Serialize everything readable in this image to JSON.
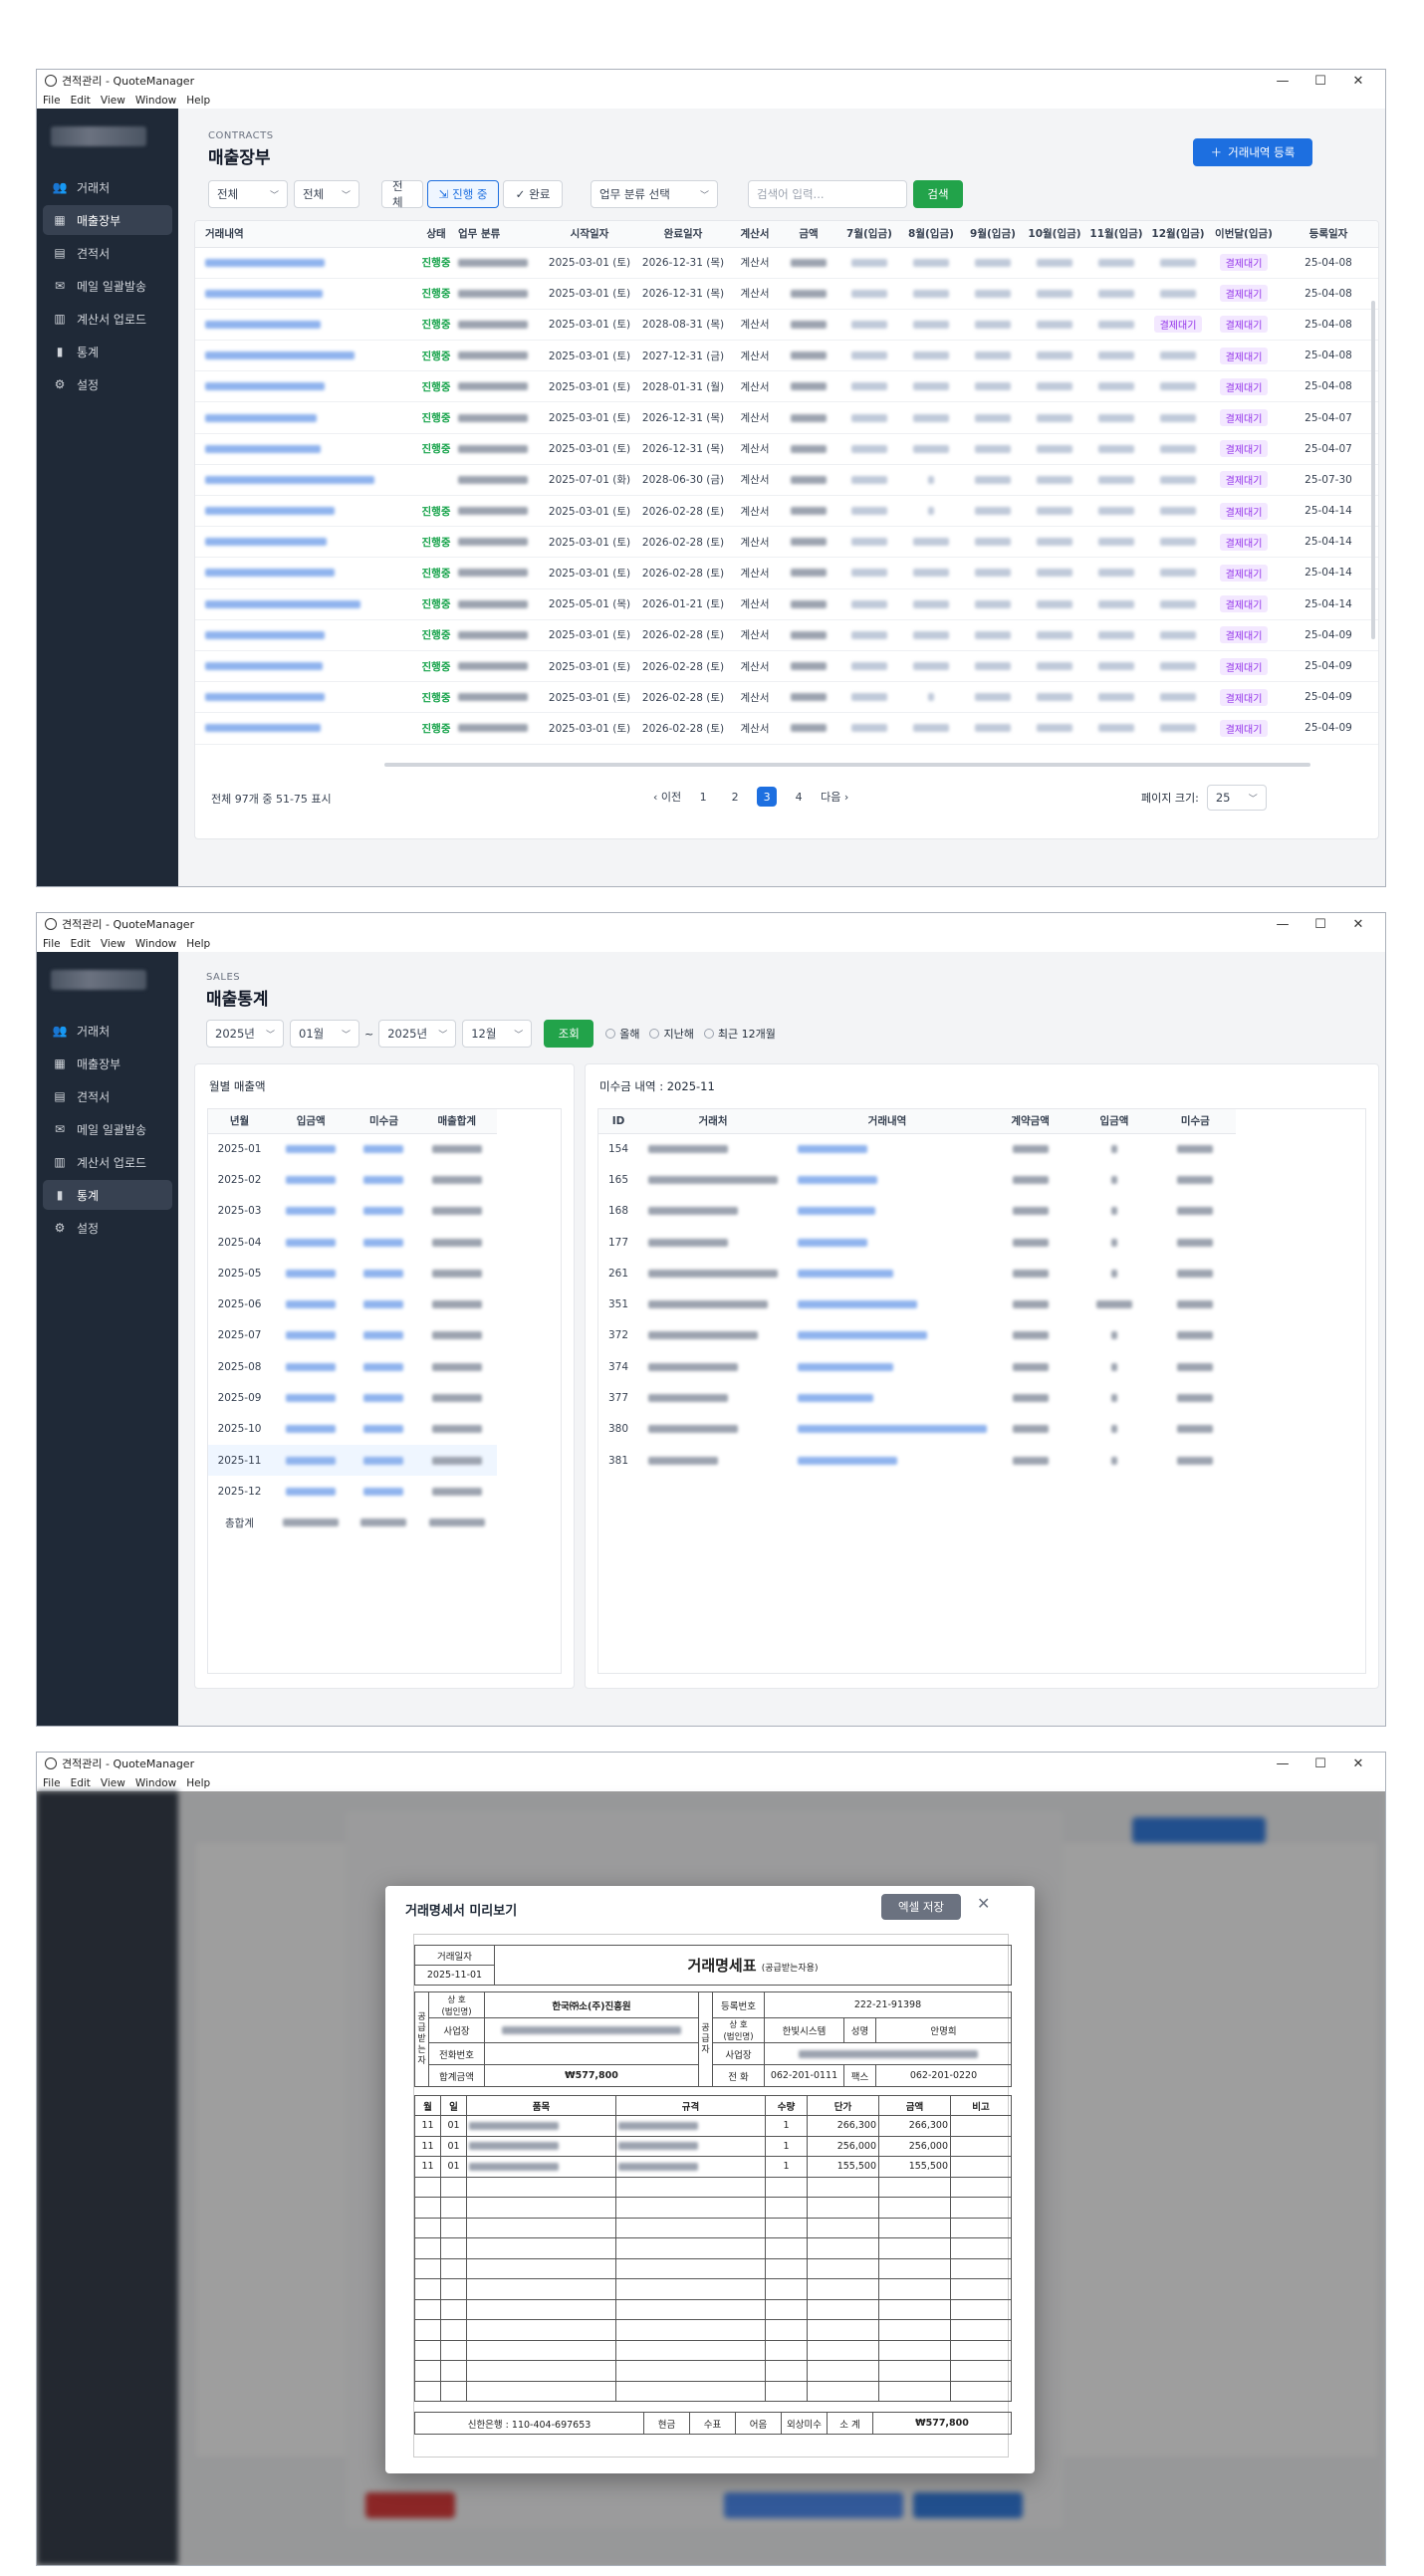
{
  "app": {
    "window_title": "견적관리 - QuoteManager",
    "menu": [
      "File",
      "Edit",
      "View",
      "Window",
      "Help"
    ]
  },
  "sidebar": {
    "items": [
      {
        "label": "거래처",
        "icon": "users-icon"
      },
      {
        "label": "매출장부",
        "icon": "grid-icon"
      },
      {
        "label": "견적서",
        "icon": "document-icon"
      },
      {
        "label": "메일 일괄발송",
        "icon": "mail-icon"
      },
      {
        "label": "계산서 업로드",
        "icon": "upload-file-icon"
      },
      {
        "label": "통계",
        "icon": "bar-chart-icon"
      },
      {
        "label": "설정",
        "icon": "gear-icon"
      }
    ]
  },
  "contracts": {
    "overline": "CONTRACTS",
    "title": "매출장부",
    "add_button": "거래내역 등록",
    "filters": {
      "select1": "전체",
      "select2": "전체",
      "seg_all": "전체",
      "seg_progress": "진행 중",
      "seg_done": "완료",
      "category": "업무 분류 선택",
      "search_placeholder": "검색어 입력...",
      "search_button": "검색"
    },
    "columns": [
      "거래내역",
      "상태",
      "업무 분류",
      "시작일자",
      "완료일자",
      "계산서",
      "금액",
      "7월(입금)",
      "8월(입금)",
      "9월(입금)",
      "10월(입금)",
      "11월(입금)",
      "12월(입금)",
      "이번달(입금)",
      "등록일자"
    ],
    "rows": [
      {
        "status": "진행중",
        "start": "2025-03-01 (토)",
        "end": "2026-12-31 (목)",
        "invoice": "계산서",
        "pay": "결제대기",
        "reg": "25-04-08",
        "dec_pill": false
      },
      {
        "status": "진행중",
        "start": "2025-03-01 (토)",
        "end": "2026-12-31 (목)",
        "invoice": "계산서",
        "pay": "결제대기",
        "reg": "25-04-08",
        "dec_pill": false
      },
      {
        "status": "진행중",
        "start": "2025-03-01 (토)",
        "end": "2028-08-31 (목)",
        "invoice": "계산서",
        "pay": "결제대기",
        "reg": "25-04-08",
        "dec_pill": true
      },
      {
        "status": "진행중",
        "start": "2025-03-01 (토)",
        "end": "2027-12-31 (금)",
        "invoice": "계산서",
        "pay": "결제대기",
        "reg": "25-04-08",
        "dec_pill": false
      },
      {
        "status": "진행중",
        "start": "2025-03-01 (토)",
        "end": "2028-01-31 (월)",
        "invoice": "계산서",
        "pay": "결제대기",
        "reg": "25-04-08",
        "dec_pill": false
      },
      {
        "status": "진행중",
        "start": "2025-03-01 (토)",
        "end": "2026-12-31 (목)",
        "invoice": "계산서",
        "pay": "결제대기",
        "reg": "25-04-07",
        "dec_pill": false
      },
      {
        "status": "진행중",
        "start": "2025-03-01 (토)",
        "end": "2026-12-31 (목)",
        "invoice": "계산서",
        "pay": "결제대기",
        "reg": "25-04-07",
        "dec_pill": false
      },
      {
        "status": "",
        "start": "2025-07-01 (화)",
        "end": "2028-06-30 (금)",
        "invoice": "계산서",
        "pay": "결제대기",
        "reg": "25-07-30",
        "dec_pill": false
      },
      {
        "status": "진행중",
        "start": "2025-03-01 (토)",
        "end": "2026-02-28 (토)",
        "invoice": "계산서",
        "pay": "결제대기",
        "reg": "25-04-14",
        "dec_pill": false
      },
      {
        "status": "진행중",
        "start": "2025-03-01 (토)",
        "end": "2026-02-28 (토)",
        "invoice": "계산서",
        "pay": "결제대기",
        "reg": "25-04-14",
        "dec_pill": false
      },
      {
        "status": "진행중",
        "start": "2025-03-01 (토)",
        "end": "2026-02-28 (토)",
        "invoice": "계산서",
        "pay": "결제대기",
        "reg": "25-04-14",
        "dec_pill": false
      },
      {
        "status": "진행중",
        "start": "2025-05-01 (목)",
        "end": "2026-01-21 (토)",
        "invoice": "계산서",
        "pay": "결제대기",
        "reg": "25-04-14",
        "dec_pill": false
      },
      {
        "status": "진행중",
        "start": "2025-03-01 (토)",
        "end": "2026-02-28 (토)",
        "invoice": "계산서",
        "pay": "결제대기",
        "reg": "25-04-09",
        "dec_pill": false
      },
      {
        "status": "진행중",
        "start": "2025-03-01 (토)",
        "end": "2026-02-28 (토)",
        "invoice": "계산서",
        "pay": "결제대기",
        "reg": "25-04-09",
        "dec_pill": false
      },
      {
        "status": "진행중",
        "start": "2025-03-01 (토)",
        "end": "2026-02-28 (토)",
        "invoice": "계산서",
        "pay": "결제대기",
        "reg": "25-04-09",
        "dec_pill": false
      },
      {
        "status": "진행중",
        "start": "2025-03-01 (토)",
        "end": "2026-02-28 (토)",
        "invoice": "계산서",
        "pay": "결제대기",
        "reg": "25-04-09",
        "dec_pill": false
      }
    ],
    "footer": {
      "summary": "전체 97개 중 51-75 표시",
      "prev": "이전",
      "next": "다음",
      "pages": [
        "1",
        "2",
        "3",
        "4"
      ],
      "current_page": "3",
      "page_size_label": "페이지 크기:",
      "page_size": "25"
    }
  },
  "sales": {
    "overline": "SALES",
    "title": "매출통계",
    "filters": {
      "year_from": "2025년",
      "month_from": "01월",
      "dash": "~",
      "year_to": "2025년",
      "month_to": "12월",
      "query_button": "조회",
      "radio_this_year": "올해",
      "radio_last_year": "지난해",
      "radio_recent": "최근 12개월"
    },
    "monthly": {
      "title": "월별 매출액",
      "columns": [
        "년월",
        "입금액",
        "미수금",
        "매출합계"
      ],
      "rows": [
        "2025-01",
        "2025-02",
        "2025-03",
        "2025-04",
        "2025-05",
        "2025-06",
        "2025-07",
        "2025-08",
        "2025-09",
        "2025-10",
        "2025-11",
        "2025-12"
      ],
      "selected": "2025-11",
      "total_label": "총합계"
    },
    "receivables": {
      "title": "미수금 내역 : 2025-11",
      "columns": [
        "ID",
        "거래처",
        "거래내역",
        "계약금액",
        "입금액",
        "미수금"
      ],
      "ids": [
        "154",
        "165",
        "168",
        "177",
        "261",
        "351",
        "372",
        "374",
        "377",
        "380",
        "381"
      ]
    }
  },
  "preview": {
    "modal_title": "거래명세서 미리보기",
    "excel_button": "엑셀 저장",
    "doc_title": "거래명세표",
    "doc_subtitle": "(공급받는자용)",
    "date_label": "거래일자",
    "date_value": "2025-11-01",
    "receiver_side": "공급받는자",
    "supplier_side": "공급자",
    "fields": {
      "company": "상 호\n(법인명)",
      "company_value": "한국㈜소(주)진흥원",
      "biz_place": "사업장",
      "phone": "전화번호",
      "total": "합계금액",
      "total_value": "₩577,800",
      "reg_no": "등록번호",
      "reg_value": "222-21-91398",
      "company2": "상 호\n(법인명)",
      "company2_value": "한빛시스템",
      "name_label": "성명",
      "name_value": "안명희",
      "biz_place2": "사업장",
      "tel": "전 화",
      "tel_value": "062-201-0111",
      "fax": "팩스",
      "fax_value": "062-201-0220"
    },
    "item_columns": [
      "월",
      "일",
      "품목",
      "규격",
      "수량",
      "단가",
      "금액",
      "비고"
    ],
    "items": [
      {
        "m": "11",
        "d": "01",
        "qty": "1",
        "price": "266,300",
        "amount": "266,300"
      },
      {
        "m": "11",
        "d": "01",
        "qty": "1",
        "price": "256,000",
        "amount": "256,000"
      },
      {
        "m": "11",
        "d": "01",
        "qty": "1",
        "price": "155,500",
        "amount": "155,500"
      }
    ],
    "footer_cells": [
      "현금",
      "수표",
      "어음",
      "외상미수",
      "소 계"
    ],
    "footer_total": "₩577,800",
    "footer_bank": "신한은행 : 110-404-697653"
  }
}
